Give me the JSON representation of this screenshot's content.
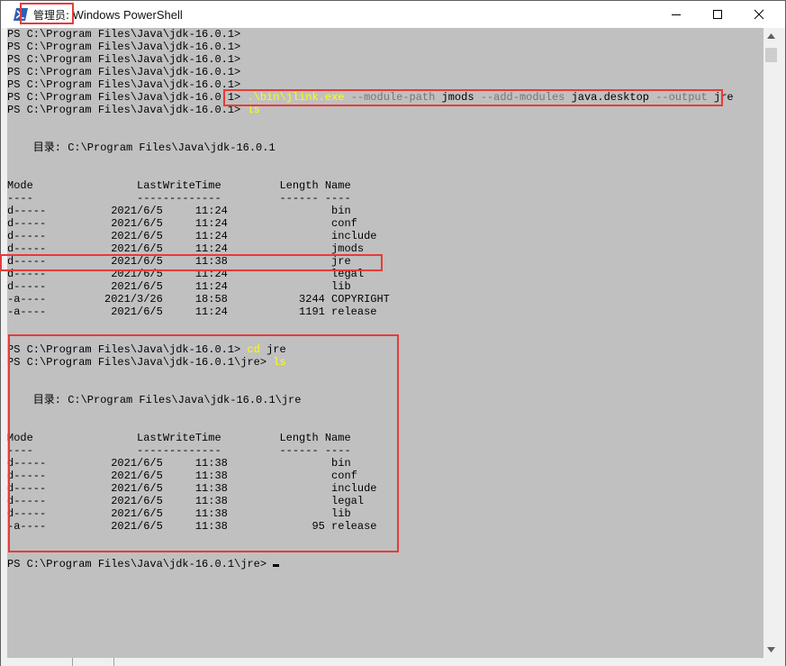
{
  "window": {
    "title_prefix": "管理员:",
    "title": " Windows PowerShell",
    "accent": "#2b5fb8"
  },
  "console": {
    "prompt": "PS C:\\Program Files\\Java\\jdk-16.0.1>",
    "prompt_jre": "PS C:\\Program Files\\Java\\jdk-16.0.1\\jre>",
    "cmd_jlink_exe": ".\\bin\\jlink.exe",
    "opt_module_path": "--module-path",
    "arg_jmods": "jmods",
    "opt_add_modules": "--add-modules",
    "arg_java_desktop": "java.desktop",
    "opt_output": "--output",
    "arg_jre": "jre",
    "cmd_ls": "ls",
    "cmd_cd": "cd",
    "arg_cd": "jre",
    "dir_label_1": "    目录: C:\\Program Files\\Java\\jdk-16.0.1",
    "dir_label_2": "    目录: C:\\Program Files\\Java\\jdk-16.0.1\\jre",
    "header": "Mode                LastWriteTime         Length Name",
    "underline": "----                -------------         ------ ----",
    "listing1": [
      "d-----          2021/6/5     11:24                bin",
      "d-----          2021/6/5     11:24                conf",
      "d-----          2021/6/5     11:24                include",
      "d-----          2021/6/5     11:24                jmods",
      "d-----          2021/6/5     11:38                jre",
      "d-----          2021/6/5     11:24                legal",
      "d-----          2021/6/5     11:24                lib",
      "-a----         2021/3/26     18:58           3244 COPYRIGHT",
      "-a----          2021/6/5     11:24           1191 release"
    ],
    "listing2": [
      "d-----          2021/6/5     11:38                bin",
      "d-----          2021/6/5     11:38                conf",
      "d-----          2021/6/5     11:38                include",
      "d-----          2021/6/5     11:38                legal",
      "d-----          2021/6/5     11:38                lib",
      "-a----          2021/6/5     11:38             95 release"
    ]
  }
}
